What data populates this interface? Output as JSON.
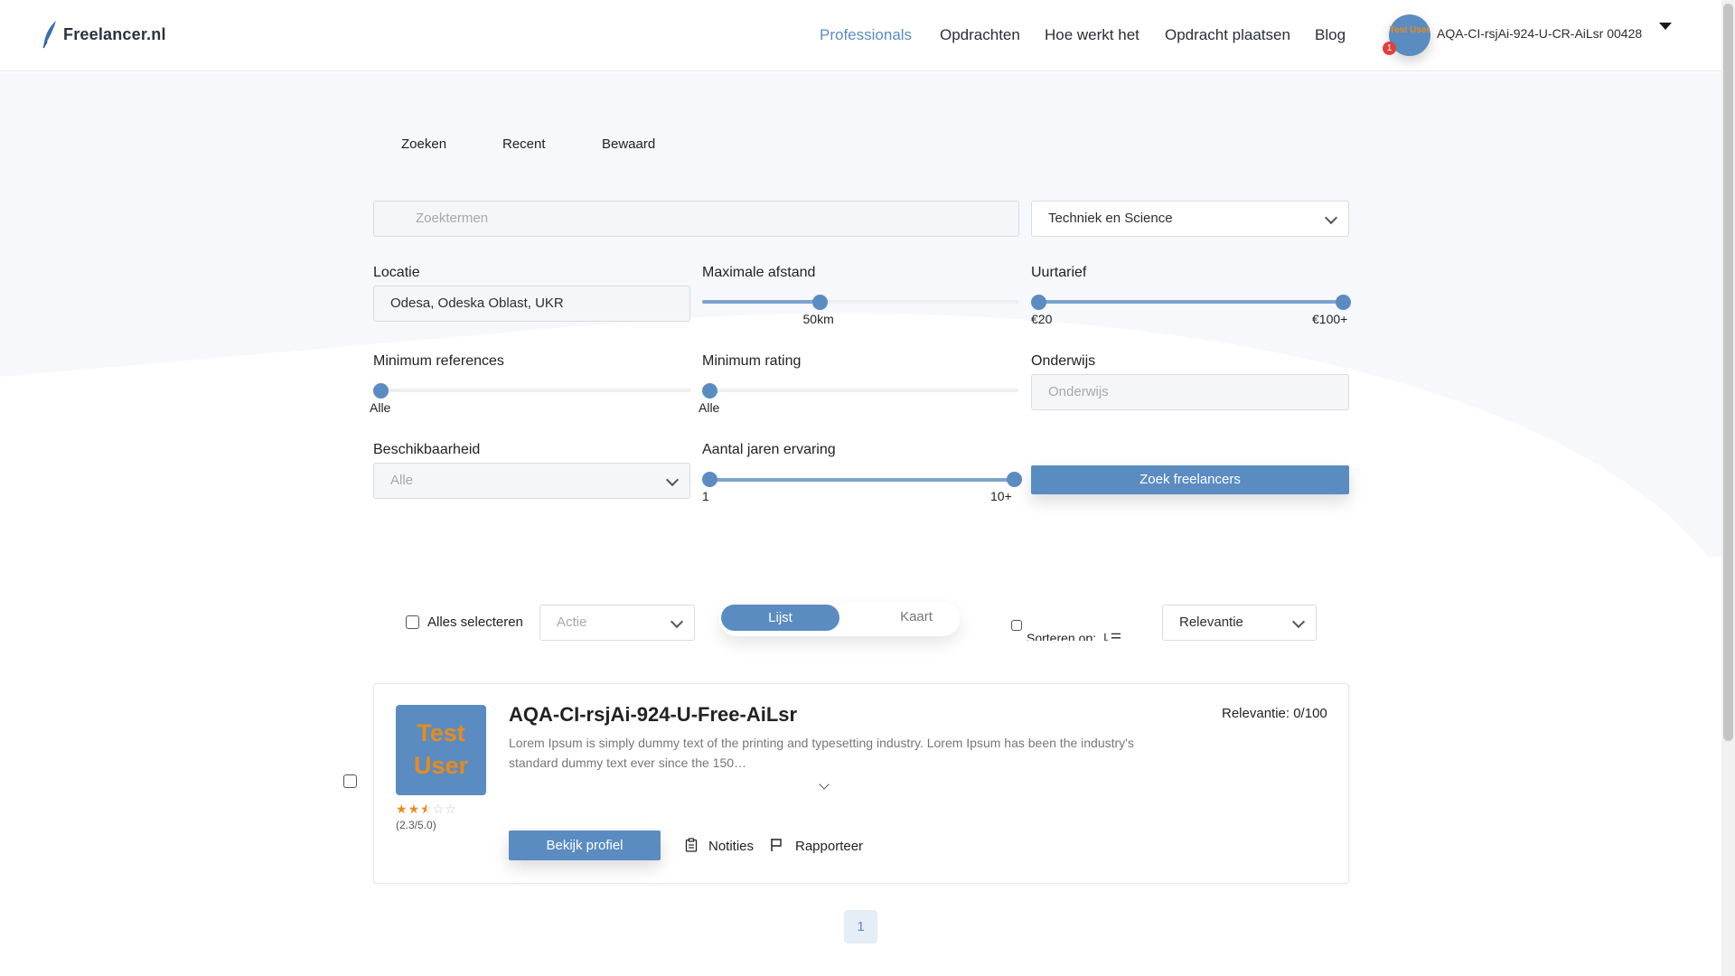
{
  "header": {
    "logo_text": "Freelancer.nl",
    "nav": [
      {
        "label": "Professionals",
        "active": true
      },
      {
        "label": "Opdrachten",
        "active": false
      },
      {
        "label": "Hoe werkt het",
        "active": false
      },
      {
        "label": "Opdracht plaatsen",
        "active": false
      },
      {
        "label": "Blog",
        "active": false
      }
    ],
    "avatar_text": "Test User",
    "notification_count": "1",
    "user_name": "AQA-CI-rsjAi-924-U-CR-AiLsr 00428"
  },
  "tabs": [
    "Zoeken",
    "Recent",
    "Bewaard"
  ],
  "search": {
    "keywords_placeholder": "Zoektermen",
    "category_value": "Techniek en Science"
  },
  "filters": {
    "location": {
      "label": "Locatie",
      "value": "Odesa, Odeska Oblast, UKR"
    },
    "distance": {
      "label": "Maximale afstand",
      "value_label": "50km",
      "fraction": 0.37
    },
    "hourly_rate": {
      "label": "Uurtarief",
      "min_label": "€20",
      "max_label": "€100+",
      "min_fraction": 0.0,
      "max_fraction": 1.0
    },
    "min_references": {
      "label": "Minimum references",
      "value_label": "Alle",
      "fraction": 0.0
    },
    "min_rating": {
      "label": "Minimum rating",
      "value_label": "Alle",
      "fraction": 0.0
    },
    "education": {
      "label": "Onderwijs",
      "placeholder": "Onderwijs"
    },
    "availability": {
      "label": "Beschikbaarheid",
      "placeholder": "Alle"
    },
    "experience": {
      "label": "Aantal jaren ervaring",
      "min_label": "1",
      "max_label": "10+",
      "min_fraction": 0.0,
      "max_fraction": 1.0
    },
    "search_button": "Zoek freelancers"
  },
  "toolbar": {
    "select_all_label": "Alles selecteren",
    "action_placeholder": "Actie",
    "view_list": "Lijst",
    "view_map": "Kaart",
    "sort_label": "Sorteren op: ⇂☰",
    "sort_value": "Relevantie"
  },
  "results": [
    {
      "photo_text": "Test User",
      "name": "AQA-CI-rsjAi-924-U-Free-AiLsr",
      "description": "Lorem Ipsum is simply dummy text of the printing and typesetting industry. Lorem Ipsum has been the industry's standard dummy text ever since the 150…",
      "rating": 2.3,
      "rating_text": "(2.3/5.0)",
      "relevance": "Relevantie: 0/100",
      "view_profile_label": "Bekijk profiel",
      "notes_label": "Notities",
      "report_label": "Rapporteer"
    }
  ],
  "pagination": {
    "current_page": "1"
  },
  "colors": {
    "accent": "#5a8cc2",
    "star": "#e88b1a",
    "badge": "#e0413d"
  }
}
